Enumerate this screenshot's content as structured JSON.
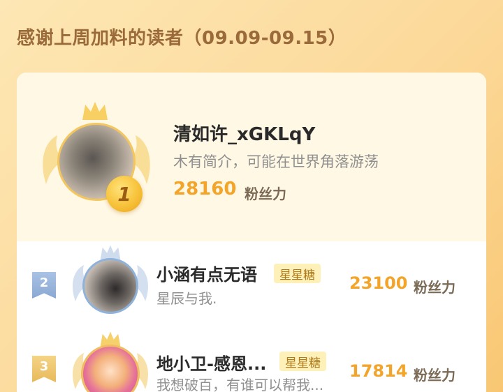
{
  "header": {
    "title": "感谢上周加料的读者（09.09-09.15）"
  },
  "top_reader": {
    "rank": "1",
    "name": "清如许_xGKLqY",
    "bio": "木有简介，可能在世界角落游荡",
    "fans_count": "28160",
    "fans_unit": "粉丝力",
    "avatar_icon": "crowned-winged-avatar-gold"
  },
  "readers": [
    {
      "rank": "2",
      "name": "小涵有点无语",
      "tag": "星星糖",
      "bio": "星辰与我.",
      "fans_count": "23100",
      "fans_unit": "粉丝力",
      "avatar_icon": "crowned-winged-avatar-silver"
    },
    {
      "rank": "3",
      "name": "地小卫-感恩...",
      "tag": "星星糖",
      "bio": "我想破百，有谁可以帮我...",
      "fans_count": "17814",
      "fans_unit": "粉丝力",
      "avatar_icon": "crowned-winged-avatar-bronze"
    }
  ],
  "colors": {
    "background": "#fcd99a",
    "accent_orange": "#f2a52a",
    "title_brown": "#9a6a3a",
    "gold": "#f4c75e",
    "silver_blue": "#8fb2db"
  }
}
